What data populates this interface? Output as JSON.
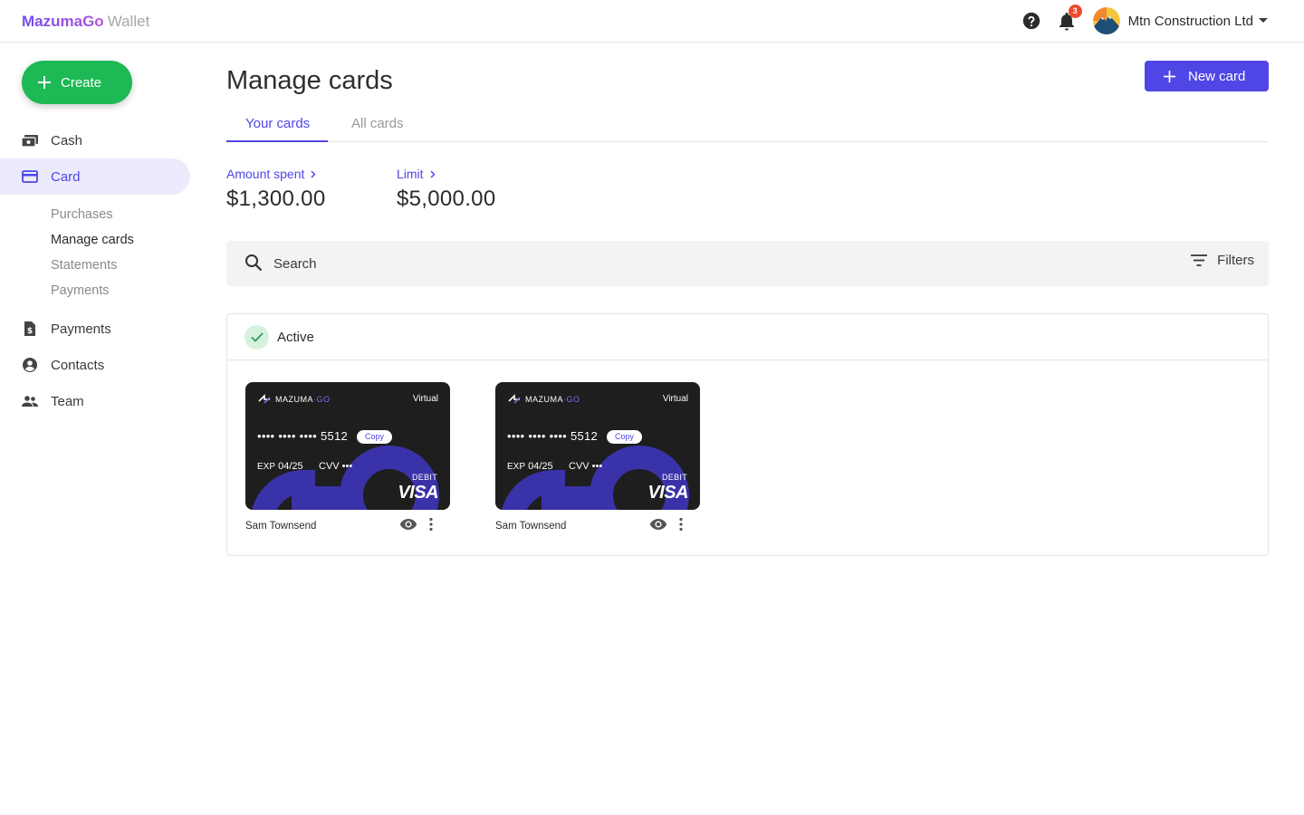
{
  "brand": {
    "name": "MazumaGo",
    "product": "Wallet"
  },
  "header": {
    "notifications_count": "3",
    "organization": "Mtn Construction Ltd"
  },
  "sidebar": {
    "create_label": "Create",
    "items": [
      {
        "label": "Cash",
        "icon": "cash-icon"
      },
      {
        "label": "Card",
        "icon": "card-icon",
        "active": true
      },
      {
        "label": "Payments",
        "icon": "payments-icon"
      },
      {
        "label": "Contacts",
        "icon": "contacts-icon"
      },
      {
        "label": "Team",
        "icon": "team-icon"
      }
    ],
    "card_subitems": [
      {
        "label": "Purchases"
      },
      {
        "label": "Manage cards",
        "current": true
      },
      {
        "label": "Statements"
      },
      {
        "label": "Payments"
      }
    ]
  },
  "main": {
    "title": "Manage cards",
    "new_card_label": "New card",
    "tabs": [
      {
        "label": "Your cards",
        "active": true
      },
      {
        "label": "All cards"
      }
    ],
    "stats": [
      {
        "label": "Amount spent",
        "value": "$1,300.00"
      },
      {
        "label": "Limit",
        "value": "$5,000.00"
      }
    ],
    "search": {
      "placeholder": "Search"
    },
    "filters_label": "Filters",
    "active_section": {
      "title": "Active",
      "cards": [
        {
          "brand_left": "MAZUMA",
          "brand_right": "GO",
          "type": "Virtual",
          "number": "•••• •••• •••• 5512",
          "copy_label": "Copy",
          "exp_label": "EXP",
          "exp": "04/25",
          "cvv": "CVV •••",
          "debit": "DEBIT",
          "network": "VISA",
          "holder": "Sam Townsend"
        },
        {
          "brand_left": "MAZUMA",
          "brand_right": "GO",
          "type": "Virtual",
          "number": "•••• •••• •••• 5512",
          "copy_label": "Copy",
          "exp_label": "EXP",
          "exp": "04/25",
          "cvv": "CVV •••",
          "debit": "DEBIT",
          "network": "VISA",
          "holder": "Sam Townsend"
        }
      ]
    }
  },
  "colors": {
    "accent": "#4f46e5",
    "create": "#1db954",
    "badge": "#f04a2a",
    "card_bg": "#1e1e1e",
    "card_art": "#3a32a8"
  }
}
